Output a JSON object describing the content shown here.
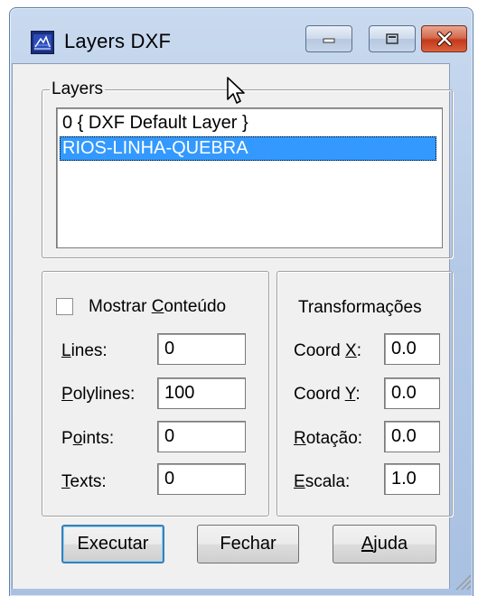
{
  "window": {
    "title": "Layers DXF",
    "controls": {
      "minimize": "minimize-icon",
      "maximize": "maximize-icon",
      "close": "close-icon"
    }
  },
  "layers_group": {
    "legend": "Layers",
    "items": [
      {
        "label": "0 { DXF Default Layer }",
        "selected": false
      },
      {
        "label": "RIOS-LINHA-QUEBRA",
        "selected": true
      }
    ]
  },
  "content_group": {
    "show_content": {
      "label_pre": "Mostrar ",
      "label_u": "C",
      "label_post": "onteúdo",
      "checked": false
    },
    "fields": [
      {
        "label_u": "L",
        "label_rest": "ines:",
        "value": "0"
      },
      {
        "label_u": "P",
        "label_rest": "olylines:",
        "value": "100"
      },
      {
        "label_pre": "P",
        "label_u": "o",
        "label_rest": "ints:",
        "value": "0"
      },
      {
        "label_u": "T",
        "label_rest": "exts:",
        "value": "0"
      }
    ]
  },
  "transform_group": {
    "title": "Transformações",
    "fields": [
      {
        "label_pre": "Coord ",
        "label_u": "X",
        "label_rest": ":",
        "value": "0.0"
      },
      {
        "label_pre": "Coord ",
        "label_u": "Y",
        "label_rest": ":",
        "value": "0.0"
      },
      {
        "label_u": "R",
        "label_rest": "otação:",
        "value": "0.0"
      },
      {
        "label_u": "E",
        "label_rest": "scala:",
        "value": "1.0"
      }
    ]
  },
  "buttons": {
    "execute": "Executar",
    "close": "Fechar",
    "help_u": "A",
    "help_rest": "juda"
  },
  "colors": {
    "selection": "#3399ff",
    "frame": "#b4c9e6",
    "close_button": "#c4381b"
  }
}
